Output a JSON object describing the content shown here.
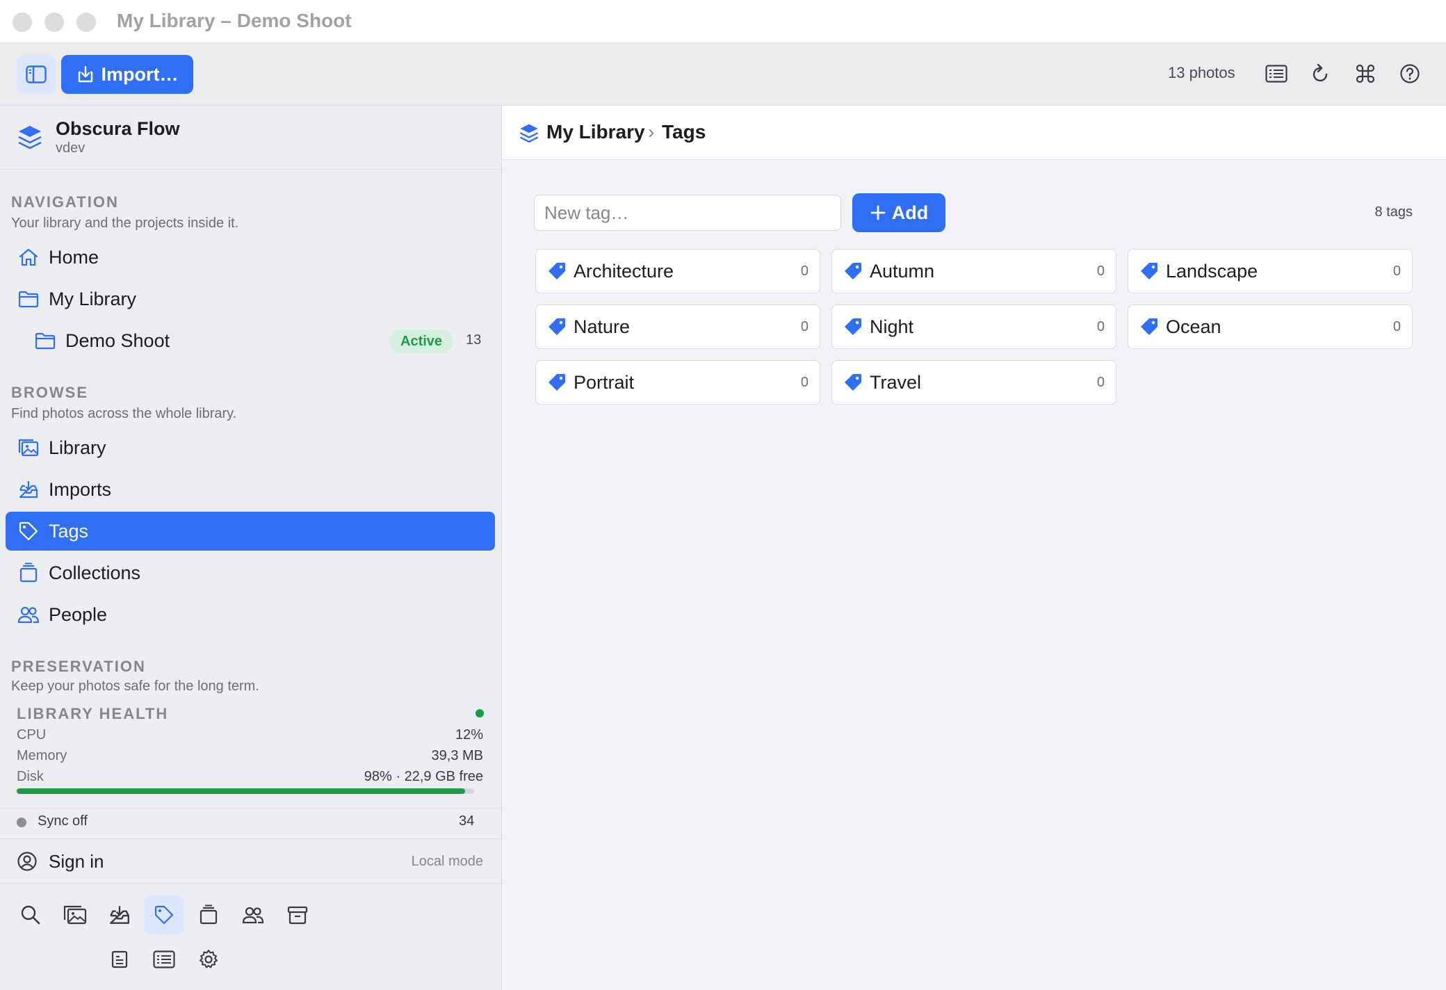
{
  "window": {
    "title": "My Library – Demo Shoot"
  },
  "toolbar": {
    "import_label": "Import…",
    "photo_count": "13 photos"
  },
  "brand": {
    "name": "Obscura Flow",
    "version": "vdev"
  },
  "navigation": {
    "title": "NAVIGATION",
    "subtitle": "Your library and the projects inside it.",
    "items": [
      {
        "label": "Home",
        "icon": "home-icon"
      },
      {
        "label": "My Library",
        "icon": "folder-icon"
      },
      {
        "label": "Demo Shoot",
        "icon": "folder-icon",
        "badge": "Active",
        "count": "13"
      }
    ]
  },
  "browse": {
    "title": "BROWSE",
    "subtitle": "Find photos across the whole library.",
    "items": [
      {
        "label": "Library",
        "icon": "photos-icon"
      },
      {
        "label": "Imports",
        "icon": "import-tray-icon"
      },
      {
        "label": "Tags",
        "icon": "tag-icon",
        "active": true
      },
      {
        "label": "Collections",
        "icon": "collections-icon"
      },
      {
        "label": "People",
        "icon": "people-icon"
      }
    ]
  },
  "preservation": {
    "title": "PRESERVATION",
    "subtitle": "Keep your photos safe for the long term."
  },
  "health": {
    "title": "LIBRARY HEALTH",
    "status_color": "#1f9a48",
    "cpu_label": "CPU",
    "cpu_value": "12%",
    "memory_label": "Memory",
    "memory_value": "39,3 MB",
    "disk_label": "Disk",
    "disk_value": "98% · 22,9 GB free",
    "disk_fraction": 0.98
  },
  "sync": {
    "label": "Sync off",
    "count": "34"
  },
  "account": {
    "signin_label": "Sign in",
    "mode": "Local mode"
  },
  "main": {
    "breadcrumb": {
      "root": "My Library",
      "separator": "›",
      "current": "Tags"
    },
    "new_tag_placeholder": "New tag…",
    "add_label": "Add",
    "tag_count": "8 tags",
    "tags": [
      {
        "name": "Architecture",
        "count": "0"
      },
      {
        "name": "Autumn",
        "count": "0"
      },
      {
        "name": "Landscape",
        "count": "0"
      },
      {
        "name": "Nature",
        "count": "0"
      },
      {
        "name": "Night",
        "count": "0"
      },
      {
        "name": "Ocean",
        "count": "0"
      },
      {
        "name": "Portrait",
        "count": "0"
      },
      {
        "name": "Travel",
        "count": "0"
      }
    ]
  },
  "colors": {
    "accent": "#2f6ef5",
    "success": "#1f9a48"
  }
}
